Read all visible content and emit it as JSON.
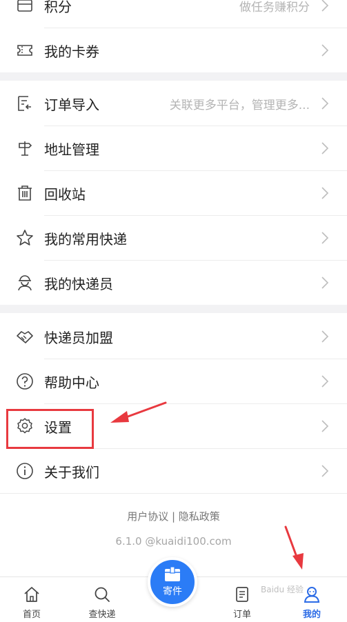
{
  "menu": {
    "points": {
      "label": "积分",
      "hint": "做任务赚积分"
    },
    "cards": {
      "label": "我的卡券"
    },
    "order_import": {
      "label": "订单导入",
      "hint": "关联更多平台，管理更多..."
    },
    "address": {
      "label": "地址管理"
    },
    "recycle": {
      "label": "回收站"
    },
    "common_express": {
      "label": "我的常用快递"
    },
    "my_courier": {
      "label": "我的快递员"
    },
    "courier_join": {
      "label": "快递员加盟"
    },
    "help": {
      "label": "帮助中心"
    },
    "settings": {
      "label": "设置"
    },
    "about": {
      "label": "关于我们"
    }
  },
  "footer": {
    "user_agreement": "用户协议",
    "separator": " | ",
    "privacy_policy": "隐私政策",
    "version": "6.1.0 @kuaidi100.com"
  },
  "tabbar": {
    "home": "首页",
    "search": "查快递",
    "send": "寄件",
    "orders": "订单",
    "mine": "我的"
  },
  "watermark": "Baidu 经验",
  "colors": {
    "accent": "#2b7cf6",
    "active_tab": "#2b6be6",
    "annotation": "#e8393f",
    "section_gap": "#f2f2f4"
  }
}
